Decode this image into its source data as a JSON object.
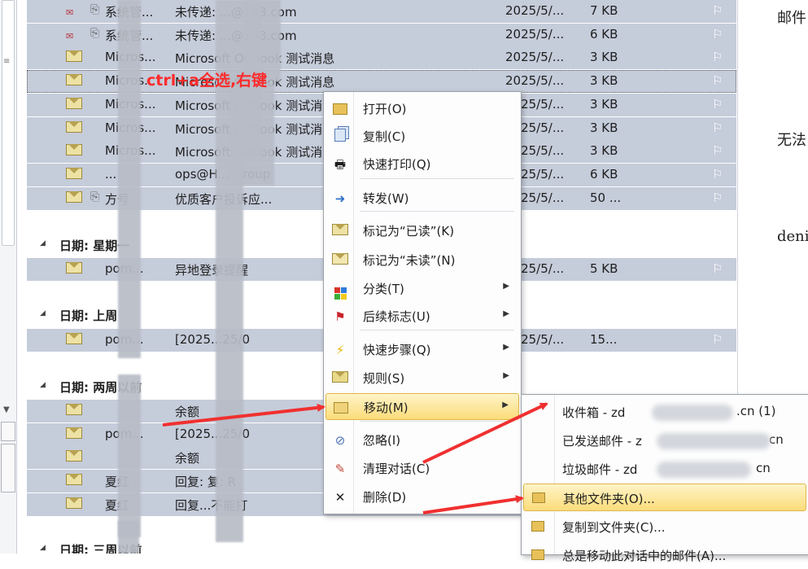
{
  "groups": [
    {
      "label": "日期: 星期一"
    },
    {
      "label": "日期: 上周"
    },
    {
      "label": "日期: 两周以前"
    },
    {
      "label": "日期: 三周以前"
    }
  ],
  "top_rows": [
    {
      "from": "系统管...",
      "subject": "未传递: ...@163.com",
      "date": "2025/5/...",
      "size": "7 KB",
      "icon": "undelivered-icon",
      "attach": true
    },
    {
      "from": "系统管...",
      "subject": "未传递: ...@163.com",
      "date": "2025/5/...",
      "size": "6 KB",
      "icon": "undelivered-icon",
      "attach": true
    },
    {
      "from": "Micros...",
      "subject": "Microsoft Outlook 测试消息",
      "date": "2025/5/...",
      "size": "3 KB",
      "icon": "envelope-icon",
      "attach": false
    },
    {
      "from": "Micros...",
      "subject": "Microsoft Outlook 测试消息",
      "date": "2025/5/...",
      "size": "3 KB",
      "icon": "envelope-icon",
      "attach": false
    },
    {
      "from": "Micros...",
      "subject": "Microsoft Outlook 测试消息",
      "date": "2025/5/...",
      "size": "3 KB",
      "icon": "envelope-icon",
      "attach": false
    },
    {
      "from": "Micros...",
      "subject": "Microsoft Outlook 测试消息",
      "date": "2025/5/...",
      "size": "3 KB",
      "icon": "envelope-icon",
      "attach": false
    },
    {
      "from": "Micros...",
      "subject": "Microsoft Outlook 测试消息",
      "date": "2025/5/...",
      "size": "3 KB",
      "icon": "envelope-icon",
      "attach": false
    },
    {
      "from": "...",
      "subject": "ops@H... Group",
      "date": "2025/5/...",
      "size": "6 KB",
      "icon": "envelope-icon",
      "attach": false
    },
    {
      "from": "方号",
      "subject": "优质客户投诉应...",
      "date": "2025/5/...",
      "size": "50 ...",
      "icon": "envelope-icon",
      "attach": true
    }
  ],
  "g1_rows": [
    {
      "from": "pom...",
      "subject": "异地登录提醒",
      "date": "2025/5/...",
      "size": "5 KB"
    }
  ],
  "g2_rows": [
    {
      "from": "pom...",
      "subject": "[2025...25/0",
      "date": "2025/5/...",
      "size": "15..."
    }
  ],
  "g3_rows": [
    {
      "from": "",
      "subject": "余额",
      "date": "",
      "size": ""
    },
    {
      "from": "pom...",
      "subject": "[2025...25/0",
      "date": "",
      "size": ""
    },
    {
      "from": "",
      "subject": "余额",
      "date": "",
      "size": ""
    },
    {
      "from": "夏红",
      "subject": "回复: 复: R",
      "date": "",
      "size": ""
    },
    {
      "from": "夏红",
      "subject": "回复...不能打",
      "date": "",
      "size": ""
    }
  ],
  "reading_pane": [
    "邮件",
    "无法",
    "deni"
  ],
  "annotation": "ctrl+a全选,右键",
  "context_menu": [
    {
      "label": "打开(O)",
      "icon": "open-folder-icon",
      "sub": false
    },
    {
      "label": "复制(C)",
      "icon": "copy-icon",
      "sub": false
    },
    {
      "label": "快速打印(Q)",
      "icon": "printer-icon",
      "sub": false
    },
    {
      "label": "转发(W)",
      "icon": "forward-icon",
      "sub": false
    },
    {
      "label": "标记为“已读”(K)",
      "icon": "mark-read-icon",
      "sub": false
    },
    {
      "label": "标记为“未读”(N)",
      "icon": "mark-unread-icon",
      "sub": false
    },
    {
      "label": "分类(T)",
      "icon": "categorize-icon",
      "sub": true
    },
    {
      "label": "后续标志(U)",
      "icon": "follow-up-flag-icon",
      "sub": true
    },
    {
      "label": "快速步骤(Q)",
      "icon": "quick-steps-icon",
      "sub": true
    },
    {
      "label": "规则(S)",
      "icon": "rules-icon",
      "sub": true
    },
    {
      "label": "移动(M)",
      "icon": "move-icon",
      "sub": true
    },
    {
      "label": "忽略(I)",
      "icon": "ignore-icon",
      "sub": false
    },
    {
      "label": "清理对话(C)",
      "icon": "clean-up-icon",
      "sub": false
    },
    {
      "label": "删除(D)",
      "icon": "delete-icon",
      "sub": false
    }
  ],
  "submenu": [
    {
      "label": "收件箱 - zd",
      "suffix": ".cn (1)"
    },
    {
      "label": "已发送邮件 - z",
      "suffix": "cn"
    },
    {
      "label": "垃圾邮件 - zd",
      "suffix": "cn"
    },
    {
      "label": "其他文件夹(O)...",
      "suffix": ""
    },
    {
      "label": "复制到文件夹(C)...",
      "suffix": ""
    },
    {
      "label": "总是移动此对话中的邮件(A)...",
      "suffix": ""
    }
  ],
  "colors": {
    "selected_row": "#c5ccda",
    "highlight": "#fbdc7a",
    "annotation": "#ff2b2b",
    "arrow": "#f03030"
  }
}
